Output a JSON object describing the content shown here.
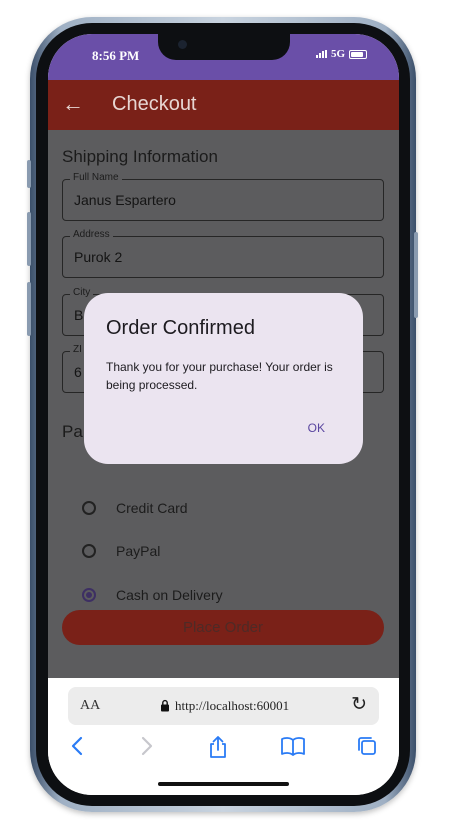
{
  "status_bar": {
    "time": "8:56 PM",
    "network": "5G"
  },
  "app_bar": {
    "back_icon": "←",
    "title": "Checkout"
  },
  "shipping": {
    "title": "Shipping Information",
    "fields": [
      {
        "label": "Full Name",
        "value": "Janus Espartero"
      },
      {
        "label": "Address",
        "value": "Purok 2"
      },
      {
        "label": "City",
        "value": "B"
      },
      {
        "label": "ZI",
        "value": "6"
      }
    ]
  },
  "payment": {
    "title": "Pa",
    "options": [
      {
        "label": "Credit Card",
        "selected": false
      },
      {
        "label": "PayPal",
        "selected": false
      },
      {
        "label": "Cash on Delivery",
        "selected": true
      }
    ]
  },
  "place_order_label": "Place Order",
  "dialog": {
    "title": "Order Confirmed",
    "body": "Thank you for your purchase! Your order is being processed.",
    "ok_label": "OK"
  },
  "browser": {
    "aa_label": "AA",
    "url": "http://localhost:60001",
    "toolbar_icons": [
      "back-icon",
      "forward-icon",
      "share-icon",
      "bookmarks-icon",
      "tabs-icon"
    ]
  },
  "colors": {
    "status_bar": "#6a4fa8",
    "app_bar": "#7a2118",
    "scrim": "#5c5c5e",
    "dialog": "#ebe4f0",
    "accent": "#5a46a0"
  }
}
